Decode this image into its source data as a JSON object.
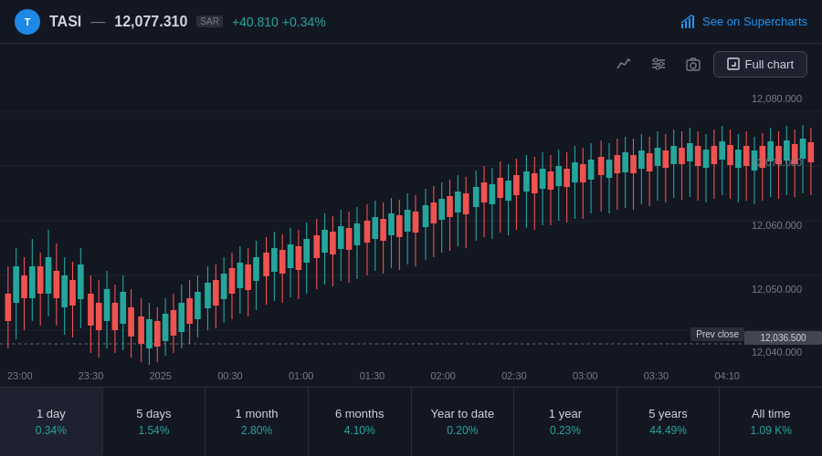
{
  "header": {
    "symbol": "TASI",
    "price": "12,077.310",
    "currency": "SAR",
    "change": "+40.810",
    "change_pct": "+0.34%",
    "supercharts_label": "See on Supercharts"
  },
  "toolbar": {
    "full_chart_label": "Full chart"
  },
  "chart": {
    "prev_close_label": "Prev close",
    "prev_close_value": "12,036.500",
    "price_levels": [
      "12,080.000",
      "12,070.000",
      "12,060.000",
      "12,050.000",
      "12,040.000"
    ],
    "time_labels": [
      "23:00",
      "23:30",
      "2025",
      "00:30",
      "01:00",
      "01:30",
      "02:00",
      "02:30",
      "03:00",
      "03:30",
      "04:10"
    ]
  },
  "periods": [
    {
      "label": "1 day",
      "change": "0.34%",
      "positive": true,
      "active": true
    },
    {
      "label": "5 days",
      "change": "1.54%",
      "positive": true,
      "active": false
    },
    {
      "label": "1 month",
      "change": "2.80%",
      "positive": true,
      "active": false
    },
    {
      "label": "6 months",
      "change": "4.10%",
      "positive": true,
      "active": false
    },
    {
      "label": "Year to date",
      "change": "0.20%",
      "positive": true,
      "active": false
    },
    {
      "label": "1 year",
      "change": "0.23%",
      "positive": true,
      "active": false
    },
    {
      "label": "5 years",
      "change": "44.49%",
      "positive": true,
      "active": false
    },
    {
      "label": "All time",
      "change": "1.09 K%",
      "positive": true,
      "active": false
    }
  ]
}
